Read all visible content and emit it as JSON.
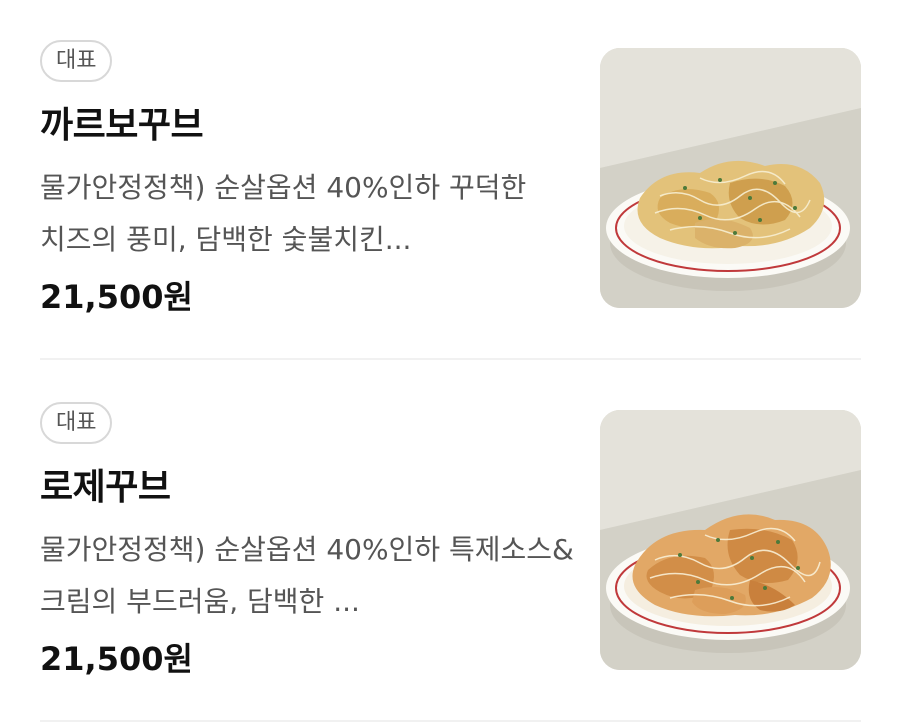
{
  "menu": {
    "items": [
      {
        "badge": "대표",
        "name": "까르보꾸브",
        "description": "물가안정정책) 순살옵션 40%인하 꾸덕한 치즈의 풍미, 담백한 숯불치킨...",
        "price": "21,500원",
        "image_icon": "chicken-dish-image"
      },
      {
        "badge": "대표",
        "name": "로제꾸브",
        "description": "물가안정정책) 순살옵션 40%인하 특제소스&크림의 부드러움, 담백한 ...",
        "price": "21,500원",
        "image_icon": "chicken-dish-image"
      }
    ]
  },
  "colors": {
    "badge_border": "#d8d8d8",
    "description": "#555555",
    "divider": "#f1f1f1",
    "plate_rim": "#c0393b",
    "thumb_background": "#dcdad1"
  }
}
